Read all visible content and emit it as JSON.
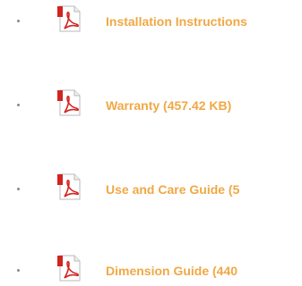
{
  "colors": {
    "link": "#f0a845",
    "icon_red": "#d3231f",
    "bullet": "#8a8a8a"
  },
  "documents": [
    {
      "label": "Installation Instructions",
      "icon": "pdf-icon"
    },
    {
      "label": "Warranty (457.42 KB)",
      "icon": "pdf-icon"
    },
    {
      "label": "Use and Care Guide (5",
      "icon": "pdf-icon"
    },
    {
      "label": "Dimension Guide (440",
      "icon": "pdf-icon"
    }
  ]
}
